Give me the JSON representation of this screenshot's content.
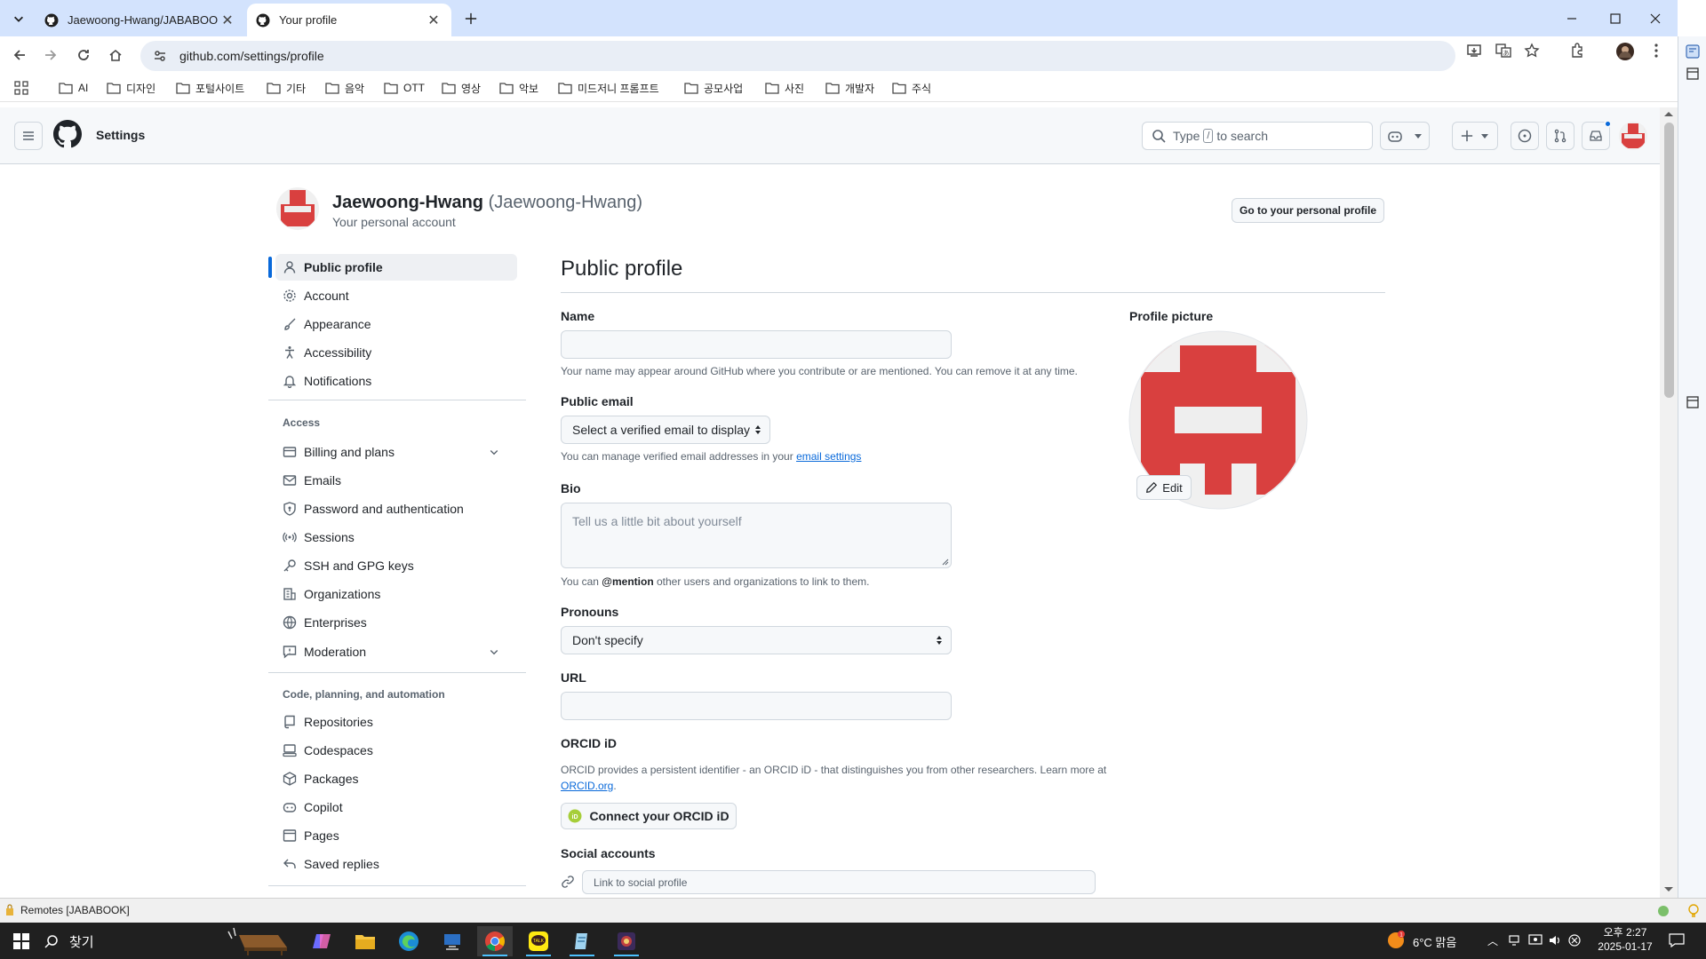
{
  "browser": {
    "tabs": [
      {
        "title": "Jaewoong-Hwang/JABABOOK",
        "active": false
      },
      {
        "title": "Your profile",
        "active": true
      }
    ],
    "url": "github.com/settings/profile",
    "bookmarks": [
      "AI",
      "디자인",
      "포털사이트",
      "기타",
      "음악",
      "OTT",
      "영상",
      "악보",
      "미드저니 프롬프트",
      "공모사업",
      "사진",
      "개발자",
      "주식"
    ]
  },
  "header": {
    "title": "Settings",
    "search_prefix": "Type",
    "search_key": "/",
    "search_suffix": "to search"
  },
  "account": {
    "name": "Jaewoong-Hwang",
    "handle": "(Jaewoong-Hwang)",
    "subtitle": "Your personal account",
    "profile_button": "Go to your personal profile"
  },
  "sidebar": {
    "items": [
      {
        "label": "Public profile",
        "icon": "person-icon"
      },
      {
        "label": "Account",
        "icon": "gear-icon"
      },
      {
        "label": "Appearance",
        "icon": "paintbrush-icon"
      },
      {
        "label": "Accessibility",
        "icon": "accessibility-icon"
      },
      {
        "label": "Notifications",
        "icon": "bell-icon"
      }
    ],
    "access_heading": "Access",
    "access_items": [
      {
        "label": "Billing and plans",
        "icon": "credit-card-icon"
      },
      {
        "label": "Emails",
        "icon": "mail-icon"
      },
      {
        "label": "Password and authentication",
        "icon": "shield-lock-icon"
      },
      {
        "label": "Sessions",
        "icon": "broadcast-icon"
      },
      {
        "label": "SSH and GPG keys",
        "icon": "key-icon"
      },
      {
        "label": "Organizations",
        "icon": "organization-icon"
      },
      {
        "label": "Enterprises",
        "icon": "globe-icon"
      },
      {
        "label": "Moderation",
        "icon": "report-icon"
      }
    ],
    "code_heading": "Code, planning, and automation",
    "code_items": [
      {
        "label": "Repositories",
        "icon": "repo-icon"
      },
      {
        "label": "Codespaces",
        "icon": "codespaces-icon"
      },
      {
        "label": "Packages",
        "icon": "package-icon"
      },
      {
        "label": "Copilot",
        "icon": "copilot-icon"
      },
      {
        "label": "Pages",
        "icon": "browser-icon"
      },
      {
        "label": "Saved replies",
        "icon": "reply-icon"
      }
    ]
  },
  "form": {
    "heading": "Public profile",
    "name_label": "Name",
    "name_value": "",
    "name_note": "Your name may appear around GitHub where you contribute or are mentioned. You can remove it at any time.",
    "email_label": "Public email",
    "email_select": "Select a verified email to display",
    "email_note_prefix": "You can manage verified email addresses in your",
    "email_note_link": "email settings",
    "bio_label": "Bio",
    "bio_placeholder": "Tell us a little bit about yourself",
    "bio_note_prefix": "You can",
    "bio_note_mention": "@mention",
    "bio_note_suffix": "other users and organizations to link to them.",
    "pronouns_label": "Pronouns",
    "pronouns_value": "Don't specify",
    "url_label": "URL",
    "url_value": "",
    "orcid_label": "ORCID iD",
    "orcid_note": "ORCID provides a persistent identifier - an ORCID iD - that distinguishes you from other researchers. Learn more at",
    "orcid_link": "ORCID.org",
    "orcid_button": "Connect your ORCID iD",
    "social_label": "Social accounts",
    "social_placeholder": "Link to social profile",
    "picture_label": "Profile picture",
    "edit_button": "Edit"
  },
  "statusbar": {
    "text": "Remotes [JABABOOK]"
  },
  "taskbar": {
    "search": "찾기",
    "weather": "6°C 맑음",
    "time": "오후 2:27",
    "date": "2025-01-17"
  },
  "colors": {
    "avatar_red": "#d9403f",
    "link_blue": "#0969da",
    "active_bar": "#0969da"
  }
}
